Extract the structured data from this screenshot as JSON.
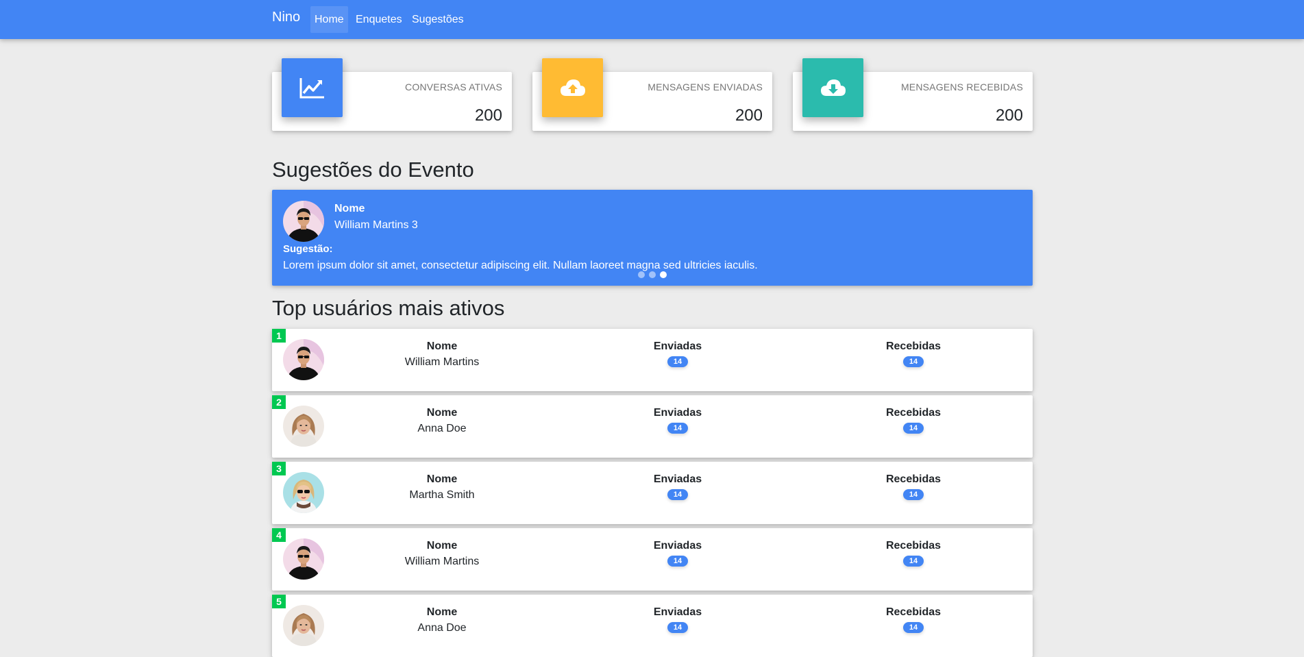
{
  "navbar": {
    "brand": "Nino",
    "items": [
      {
        "label": "Home"
      },
      {
        "label": "Enquetes"
      },
      {
        "label": "Sugestões"
      }
    ]
  },
  "stats": [
    {
      "label": "CONVERSAS ATIVAS",
      "value": "200",
      "icon": "chart-line-icon",
      "color": "#4285f4"
    },
    {
      "label": "MENSAGENS ENVIADAS",
      "value": "200",
      "icon": "cloud-upload-icon",
      "color": "#ffbb33"
    },
    {
      "label": "MENSAGENS RECEBIDAS",
      "value": "200",
      "icon": "cloud-download-icon",
      "color": "#2bbbad"
    }
  ],
  "suggestions": {
    "title": "Sugestões do Evento",
    "name_label": "Nome",
    "name": "William Martins 3",
    "suggestion_label": "Sugestão:",
    "suggestion_text": "Lorem ipsum dolor sit amet, consectetur adipiscing elit. Nullam laoreet magna sed ultricies iaculis.",
    "slides": 3,
    "active_slide": 3
  },
  "top_users": {
    "title": "Top usuários mais ativos",
    "headers": {
      "name": "Nome",
      "sent": "Enviadas",
      "received": "Recebidas"
    },
    "rows": [
      {
        "rank": "1",
        "name": "William Martins",
        "sent": "14",
        "received": "14",
        "avatar": "man-avatar"
      },
      {
        "rank": "2",
        "name": "Anna Doe",
        "sent": "14",
        "received": "14",
        "avatar": "woman-avatar"
      },
      {
        "rank": "3",
        "name": "Martha Smith",
        "sent": "14",
        "received": "14",
        "avatar": "woman-sunglasses-avatar"
      },
      {
        "rank": "4",
        "name": "William Martins",
        "sent": "14",
        "received": "14",
        "avatar": "man-avatar"
      },
      {
        "rank": "5",
        "name": "Anna Doe",
        "sent": "14",
        "received": "14",
        "avatar": "woman-avatar"
      }
    ]
  },
  "colors": {
    "primary": "#4285f4",
    "warning": "#ffbb33",
    "teal": "#2bbbad",
    "rank_badge": "#00c851"
  }
}
